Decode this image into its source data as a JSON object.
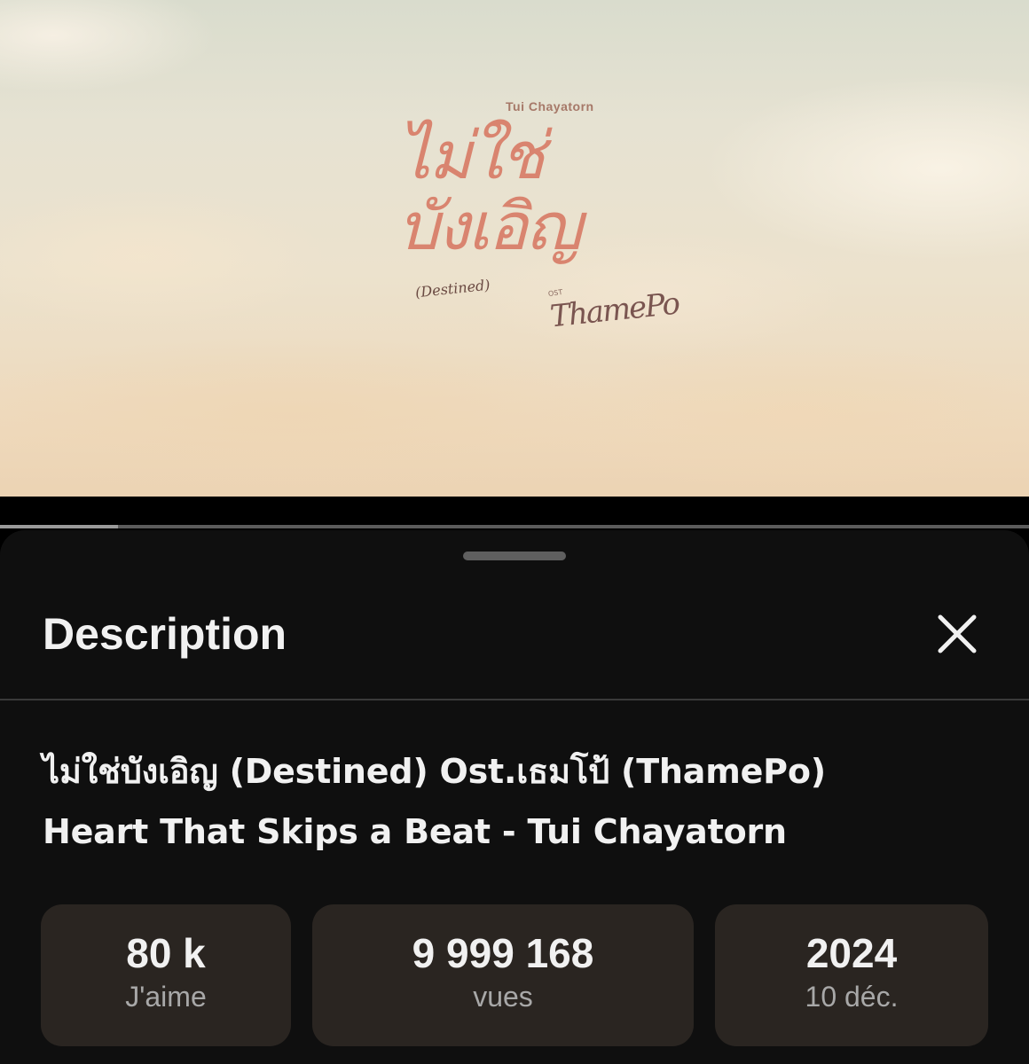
{
  "video": {
    "title_artwork": {
      "artist": "Tui Chayatorn",
      "thai_title_line1": "ไม่ใช่",
      "thai_title_line2": "บังเอิญ",
      "english_title": "(Destined)",
      "ost_label": "OST",
      "drama_logo": "ThamePo"
    },
    "progress_fraction": 0.115
  },
  "sheet": {
    "title": "Description",
    "close_icon": "close-icon",
    "video_title_line1": "ไม่ใช่บังเอิญ (Destined) Ost.เธมโป้ (ThamePo)",
    "video_title_line2": "Heart That Skips a Beat - Tui Chayatorn",
    "stats": [
      {
        "value": "80 k",
        "label": "J'aime"
      },
      {
        "value": "9 999 168",
        "label": "vues"
      },
      {
        "value": "2024",
        "label": "10 déc."
      }
    ]
  },
  "colors": {
    "sheet_bg": "#0f0f0f",
    "stat_card_bg": "#2a2521",
    "text_primary": "#f1f1f1",
    "text_secondary": "#a8a8a8"
  }
}
